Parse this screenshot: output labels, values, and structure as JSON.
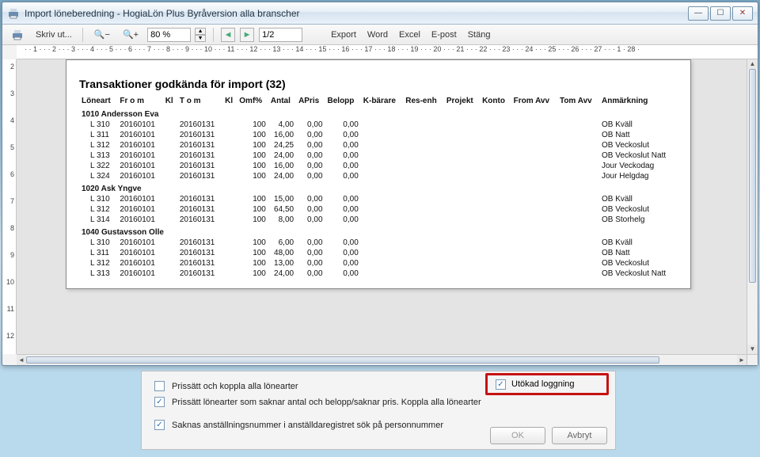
{
  "window": {
    "title": "Import löneberedning - HogiaLön Plus Byråversion alla branscher"
  },
  "toolbar": {
    "print_label": "Skriv ut...",
    "zoom_value": "80 %",
    "page_value": "1/2",
    "links": {
      "export": "Export",
      "word": "Word",
      "excel": "Excel",
      "epost": "E-post",
      "stang": "Stäng"
    }
  },
  "ruler_h": "· · 1 · · · 2 · · · 3 · · · 4 · · · 5 · · · 6 · · · 7 · · · 8 · · · 9 · · · 10 · · · 11 · · · 12 · · · 13 · · · 14 · · · 15 · · · 16 · · · 17 · · · 18 · · · 19 · · · 20 · · · 21 · · · 22 · · · 23 · · · 24 · · · 25 · · · 26 · · · 27 · · · 1 · 28 ·",
  "ruler_v": [
    "2",
    "3",
    "4",
    "5",
    "6",
    "7",
    "8",
    "9",
    "10",
    "11",
    "12"
  ],
  "report": {
    "title": "Transaktioner godkända för import (32)",
    "columns": [
      "Löneart",
      "Fr o m",
      "Kl",
      "T o m",
      "Kl",
      "Omf%",
      "Antal",
      "APris",
      "Belopp",
      "K-bärare",
      "Res-enh",
      "Projekt",
      "Konto",
      "From Avv",
      "Tom Avv",
      "Anmärkning"
    ],
    "groups": [
      {
        "id": "1010",
        "name": "Andersson Eva",
        "rows": [
          {
            "art": "L 310",
            "from": "20160101",
            "tom": "20160131",
            "omf": "100",
            "antal": "4,00",
            "apris": "0,00",
            "belopp": "0,00",
            "anm": "OB Kväll"
          },
          {
            "art": "L 311",
            "from": "20160101",
            "tom": "20160131",
            "omf": "100",
            "antal": "16,00",
            "apris": "0,00",
            "belopp": "0,00",
            "anm": "OB Natt"
          },
          {
            "art": "L 312",
            "from": "20160101",
            "tom": "20160131",
            "omf": "100",
            "antal": "24,25",
            "apris": "0,00",
            "belopp": "0,00",
            "anm": "OB Veckoslut"
          },
          {
            "art": "L 313",
            "from": "20160101",
            "tom": "20160131",
            "omf": "100",
            "antal": "24,00",
            "apris": "0,00",
            "belopp": "0,00",
            "anm": "OB Veckoslut Natt"
          },
          {
            "art": "L 322",
            "from": "20160101",
            "tom": "20160131",
            "omf": "100",
            "antal": "16,00",
            "apris": "0,00",
            "belopp": "0,00",
            "anm": "Jour Veckodag"
          },
          {
            "art": "L 324",
            "from": "20160101",
            "tom": "20160131",
            "omf": "100",
            "antal": "24,00",
            "apris": "0,00",
            "belopp": "0,00",
            "anm": "Jour Helgdag"
          }
        ]
      },
      {
        "id": "1020",
        "name": "Ask Yngve",
        "rows": [
          {
            "art": "L 310",
            "from": "20160101",
            "tom": "20160131",
            "omf": "100",
            "antal": "15,00",
            "apris": "0,00",
            "belopp": "0,00",
            "anm": "OB Kväll"
          },
          {
            "art": "L 312",
            "from": "20160101",
            "tom": "20160131",
            "omf": "100",
            "antal": "64,50",
            "apris": "0,00",
            "belopp": "0,00",
            "anm": "OB Veckoslut"
          },
          {
            "art": "L 314",
            "from": "20160101",
            "tom": "20160131",
            "omf": "100",
            "antal": "8,00",
            "apris": "0,00",
            "belopp": "0,00",
            "anm": "OB Storhelg"
          }
        ]
      },
      {
        "id": "1040",
        "name": "Gustavsson Olle",
        "rows": [
          {
            "art": "L 310",
            "from": "20160101",
            "tom": "20160131",
            "omf": "100",
            "antal": "6,00",
            "apris": "0,00",
            "belopp": "0,00",
            "anm": "OB Kväll"
          },
          {
            "art": "L 311",
            "from": "20160101",
            "tom": "20160131",
            "omf": "100",
            "antal": "48,00",
            "apris": "0,00",
            "belopp": "0,00",
            "anm": "OB Natt"
          },
          {
            "art": "L 312",
            "from": "20160101",
            "tom": "20160131",
            "omf": "100",
            "antal": "13,00",
            "apris": "0,00",
            "belopp": "0,00",
            "anm": "OB Veckoslut"
          },
          {
            "art": "L 313",
            "from": "20160101",
            "tom": "20160131",
            "omf": "100",
            "antal": "24,00",
            "apris": "0,00",
            "belopp": "0,00",
            "anm": "OB Veckoslut Natt"
          }
        ]
      }
    ]
  },
  "panel": {
    "chk1": "Prissätt och koppla alla lönearter",
    "chk2": "Prissätt lönearter som saknar antal och belopp/saknar pris. Koppla alla lönearter",
    "chk3": "Saknas anställningsnummer i anställdaregistret sök på personnummer",
    "chk_log": "Utökad loggning",
    "ok": "OK",
    "cancel": "Avbryt"
  }
}
